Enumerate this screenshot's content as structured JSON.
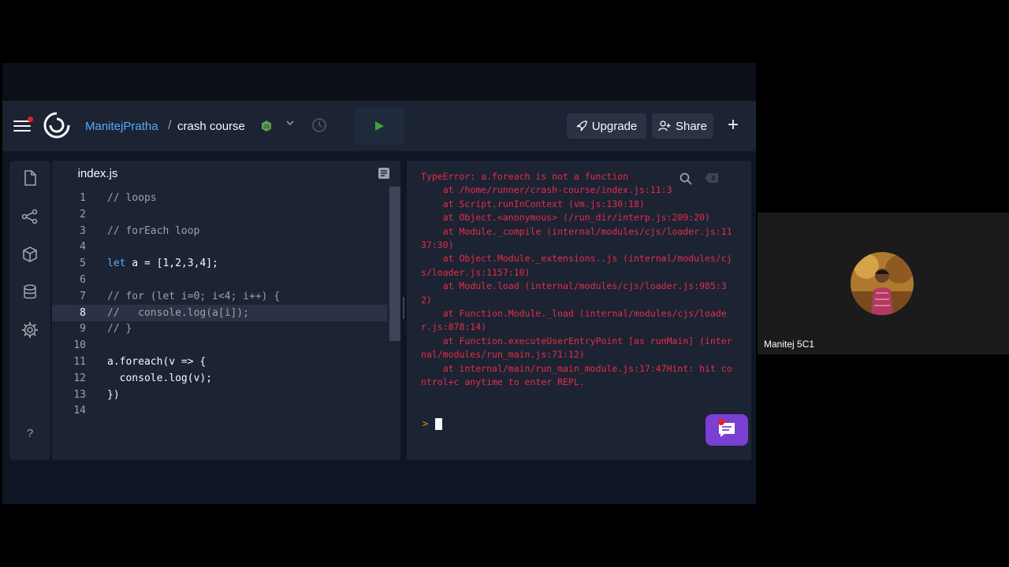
{
  "header": {
    "username": "ManitejPratha",
    "separator": "/",
    "project": "crash course",
    "upgrade_label": "Upgrade",
    "share_label": "Share",
    "plus_label": "+"
  },
  "editor": {
    "tab_label": "index.js",
    "current_line": 8,
    "lines": [
      {
        "n": "1",
        "text": "// loops"
      },
      {
        "n": "2",
        "text": ""
      },
      {
        "n": "3",
        "text": "// forEach loop"
      },
      {
        "n": "4",
        "text": ""
      },
      {
        "n": "5",
        "text": "let a = [1,2,3,4];"
      },
      {
        "n": "6",
        "text": ""
      },
      {
        "n": "7",
        "text": "// for (let i=0; i<4; i++) {"
      },
      {
        "n": "8",
        "text": "//   console.log(a[i]);"
      },
      {
        "n": "9",
        "text": "// }"
      },
      {
        "n": "10",
        "text": ""
      },
      {
        "n": "11",
        "text": "a.foreach(v => {"
      },
      {
        "n": "12",
        "text": "  console.log(v);"
      },
      {
        "n": "13",
        "text": "})"
      },
      {
        "n": "14",
        "text": ""
      }
    ]
  },
  "console": {
    "output": "TypeError: a.foreach is not a function\n    at /home/runner/crash-course/index.js:11:3\n    at Script.runInContext (vm.js:130:18)\n    at Object.<anonymous> (/run_dir/interp.js:209:20)\n    at Module._compile (internal/modules/cjs/loader.js:1137:30)\n    at Object.Module._extensions..js (internal/modules/cjs/loader.js:1157:10)\n    at Module.load (internal/modules/cjs/loader.js:985:32)\n    at Function.Module._load (internal/modules/cjs/loader.js:878:14)\n    at Function.executeUserEntryPoint [as runMain] (internal/modules/run_main.js:71:12)\n    at internal/main/run_main_module.js:17:47Hint: hit control+c anytime to enter REPL.",
    "prompt": ">"
  },
  "help_label": "?",
  "participant": {
    "name": "Manitej 5C1"
  },
  "colors": {
    "accent_blue": "#57abff",
    "error_red": "#e52e47",
    "run_green": "#3ea33b",
    "chat_purple": "#7b3fd3"
  },
  "icons": [
    "hamburger-menu-icon",
    "replit-logo-icon",
    "nodejs-icon",
    "chevron-down-icon",
    "history-icon",
    "run-icon",
    "rocket-icon",
    "add-person-icon",
    "file-icon",
    "git-icon",
    "packages-icon",
    "database-icon",
    "settings-icon",
    "search-icon",
    "clear-icon",
    "chat-icon"
  ]
}
